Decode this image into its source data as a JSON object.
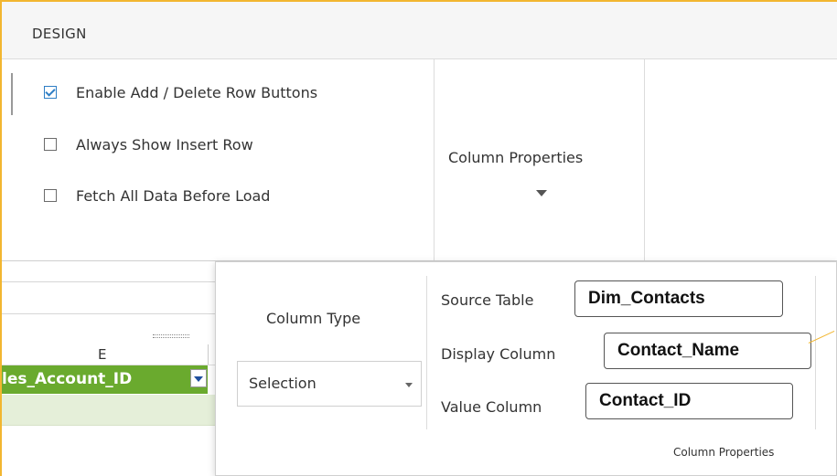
{
  "tab": {
    "label": "DESIGN"
  },
  "ribbon": {
    "options": [
      {
        "label": "Enable Add / Delete Row Buttons",
        "checked": true
      },
      {
        "label": "Always Show Insert Row",
        "checked": false
      },
      {
        "label": "Fetch All Data Before Load",
        "checked": false
      }
    ],
    "column_properties_label": "Column Properties"
  },
  "sheet": {
    "column_letter": "E",
    "header_cell_text": "les_Account_ID",
    "header_color": "#6aaa2e"
  },
  "popover": {
    "column_type_label": "Column Type",
    "column_type_value": "Selection",
    "source_table_label": "Source Table",
    "source_table_value": "Dim_Contacts",
    "display_column_label": "Display Column",
    "display_column_value": "Contact_Name",
    "value_column_label": "Value Column",
    "value_column_value": "Contact_ID",
    "group_label": "Column Properties"
  },
  "colors": {
    "accent": "#f2b630",
    "check": "#2e7ec5"
  }
}
